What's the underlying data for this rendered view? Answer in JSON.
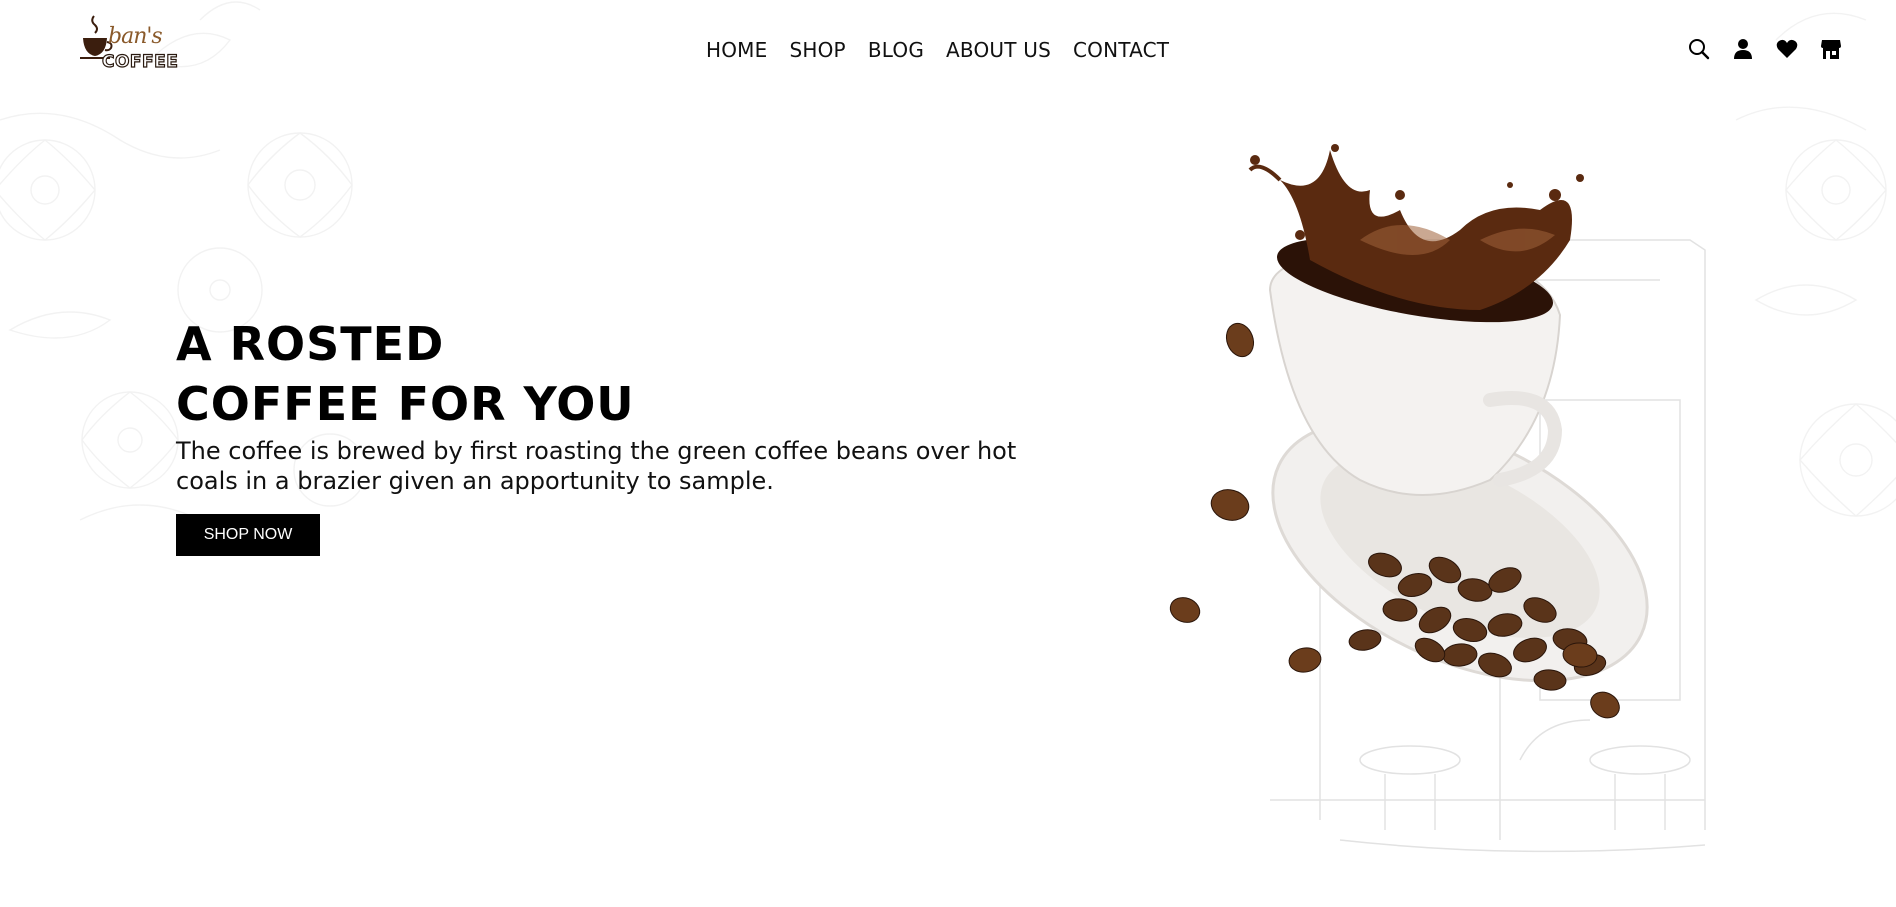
{
  "brand": {
    "script": "ban's",
    "word": "COFFEE"
  },
  "nav": {
    "items": [
      "HOME",
      "SHOP",
      "BLOG",
      "ABOUT US",
      "CONTACT"
    ]
  },
  "header_icons": [
    "search-icon",
    "user-icon",
    "heart-icon",
    "store-icon"
  ],
  "hero": {
    "title_line1": "A ROSTED",
    "title_line2": "COFFEE FOR YOU",
    "description": "The coffee is brewed by first roasting the green coffee beans over hot coals in a brazier given an apportunity to sample.",
    "cta_label": "SHOP NOW"
  },
  "colors": {
    "accent": "#000000",
    "brand_brown": "#8a5a2b",
    "coffee": "#3b1e0e"
  }
}
